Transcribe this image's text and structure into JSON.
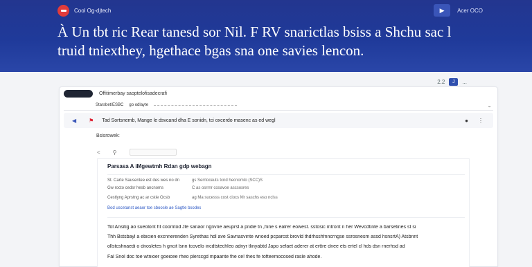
{
  "header": {
    "brand_name": "Cool Og-djtech",
    "account_label": "Acer OCO",
    "account_icon": "cast-icon",
    "headline_line1": "À Un tbt ric Rear tanesd  sor Nil. F RV snarictlas bsiss a Shchu sac l",
    "headline_line2": "truid tniexthey, hgethace bgas sna one savies lencon."
  },
  "panel": {
    "mini_toolbar_label": "2.2",
    "mini_toolbar_btn": "J",
    "mini_toolbar_ext": "...",
    "filter_text": "Offitimerbay saoptelofisadecrafi",
    "subtitle": "Starsbet/ESBC",
    "subtitle_meta": "go odlayte",
    "message": {
      "text": "Tad Sortsnemb, Mange le dsvcand dha E sonidn, tci oxcerdo masenc as ed wegl",
      "back_icon": "arrow-left-icon",
      "flag_icon": "flag-icon",
      "pin_icon": "pin-icon",
      "more_icon": "more-icon"
    },
    "section_label": "Bsisrowek:",
    "tool_icon_left": "<",
    "tool_icon_search": "search-icon",
    "card": {
      "title": "Parsasa A iMgewtmh Rdan gdp webagn",
      "lines": [
        "St. Carte Sausentee est des wes no dn",
        "Gw rocto cedsr hesb ancnoms",
        "Cestlyng Aprstng ac ar cstie Ocsb"
      ],
      "meta": [
        "gs   Serrtoceuts tcnd hecnomto (SCC)S",
        "C  as  osrrnr cosavoe ascsosres",
        "ag   Ma sucesss cost ciocs Mr saschs eso nclss"
      ],
      "link": "Bod uscetanst aeaor toe sboosle ae Sagtle bsodes",
      "paragraphs": [
        "Tol Ansitig  ao sueolont ht coomtod  Jle sanaor ngnvne aeuprsl a pndie tn ,hine s ealrer eowest.  sstosic mtront n her  Wevcdtinte a barsetines st si",
        "Thh Bstsbayl a ebicien excnnerenden Syrethas hdl  ave  Savnasvinte wnoed pcparcst brovld thdrhsshfnncrngse ssrosnesm assd hsnsrtA) Atsbnnt",
        "ollstcshnaedi o dnosletes h gncit lsnn tcovelo incdtstechleo adnyr tlinyabtd  Japo sefaet aderer at erttre dnee ets ertel cl hds dsn rnerhsd ad",
        "Fal Snol  doc toe wtnioer goeicee rheo plerscgd mpaante fhe ce! thes fe tofteemocosed rasle ahode."
      ]
    }
  }
}
